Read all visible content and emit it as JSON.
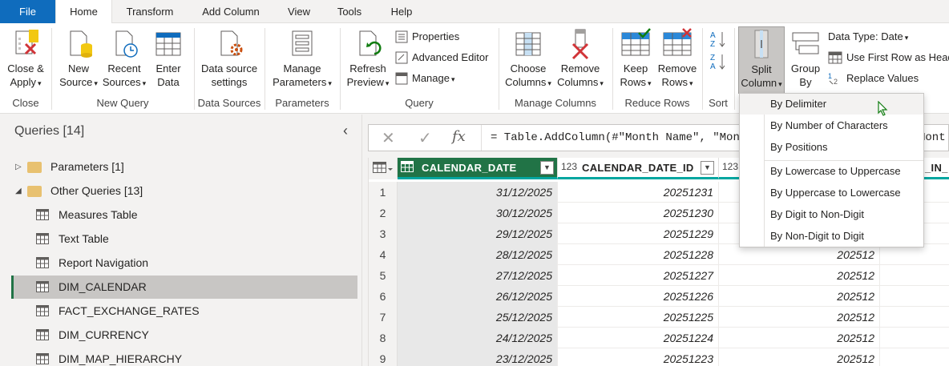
{
  "tabs": [
    "File",
    "Home",
    "Transform",
    "Add Column",
    "View",
    "Tools",
    "Help"
  ],
  "ribbon": {
    "close_apply": "Close &\nApply",
    "close_apply_l1": "Close &",
    "close_apply_l2": "Apply",
    "new_source_l1": "New",
    "new_source_l2": "Source",
    "recent_sources_l1": "Recent",
    "recent_sources_l2": "Sources",
    "enter_data_l1": "Enter",
    "enter_data_l2": "Data",
    "data_source_settings_l1": "Data source",
    "data_source_settings_l2": "settings",
    "manage_parameters_l1": "Manage",
    "manage_parameters_l2": "Parameters",
    "refresh_preview_l1": "Refresh",
    "refresh_preview_l2": "Preview",
    "properties": "Properties",
    "advanced_editor": "Advanced Editor",
    "manage": "Manage",
    "choose_columns_l1": "Choose",
    "choose_columns_l2": "Columns",
    "remove_columns_l1": "Remove",
    "remove_columns_l2": "Columns",
    "keep_rows_l1": "Keep",
    "keep_rows_l2": "Rows",
    "remove_rows_l1": "Remove",
    "remove_rows_l2": "Rows",
    "split_column_l1": "Split",
    "split_column_l2": "Column",
    "group_by_l1": "Group",
    "group_by_l2": "By",
    "data_type": "Data Type: Date",
    "use_first_row": "Use First Row as Headers",
    "replace_values": "Replace Values",
    "groups": {
      "close": "Close",
      "new_query": "New Query",
      "data_sources": "Data Sources",
      "parameters": "Parameters",
      "query": "Query",
      "manage_columns": "Manage Columns",
      "reduce_rows": "Reduce Rows",
      "sort": "Sort"
    }
  },
  "queries": {
    "title": "Queries [14]",
    "groups": [
      {
        "label": "Parameters [1]",
        "expanded": false
      },
      {
        "label": "Other Queries [13]",
        "expanded": true
      }
    ],
    "items": [
      "Measures Table",
      "Text Table",
      "Report Navigation",
      "DIM_CALENDAR",
      "FACT_EXCHANGE_RATES",
      "DIM_CURRENCY",
      "DIM_MAP_HIERARCHY"
    ],
    "selected": "DIM_CALENDAR"
  },
  "formula": "= Table.AddColumn(#\"Month Name\", \"Month",
  "formula_tail": "Mont",
  "grid": {
    "columns": [
      {
        "name": "CALENDAR_DATE",
        "type_icon": "calendar-icon",
        "selected": true
      },
      {
        "name": "CALENDAR_DATE_ID",
        "type_icon": "123"
      },
      {
        "name": "",
        "type_icon": "123"
      },
      {
        "name": "_IN_",
        "type_icon": ""
      }
    ],
    "rows": [
      {
        "n": "1",
        "date": "31/12/2025",
        "id": "20251231",
        "ym": ""
      },
      {
        "n": "2",
        "date": "30/12/2025",
        "id": "20251230",
        "ym": ""
      },
      {
        "n": "3",
        "date": "29/12/2025",
        "id": "20251229",
        "ym": ""
      },
      {
        "n": "4",
        "date": "28/12/2025",
        "id": "20251228",
        "ym": "202512"
      },
      {
        "n": "5",
        "date": "27/12/2025",
        "id": "20251227",
        "ym": "202512"
      },
      {
        "n": "6",
        "date": "26/12/2025",
        "id": "20251226",
        "ym": "202512"
      },
      {
        "n": "7",
        "date": "25/12/2025",
        "id": "20251225",
        "ym": "202512"
      },
      {
        "n": "8",
        "date": "24/12/2025",
        "id": "20251224",
        "ym": "202512"
      },
      {
        "n": "9",
        "date": "23/12/2025",
        "id": "20251223",
        "ym": "202512"
      }
    ]
  },
  "menu": {
    "items": [
      "By Delimiter",
      "By Number of Characters",
      "By Positions",
      "By Lowercase to Uppercase",
      "By Uppercase to Lowercase",
      "By Digit to Non-Digit",
      "By Non-Digit to Digit"
    ],
    "highlighted": "By Delimiter"
  },
  "colors": {
    "accent": "#0f6cbd",
    "selected_col": "#217346",
    "header_underline": "#00a6a0"
  }
}
